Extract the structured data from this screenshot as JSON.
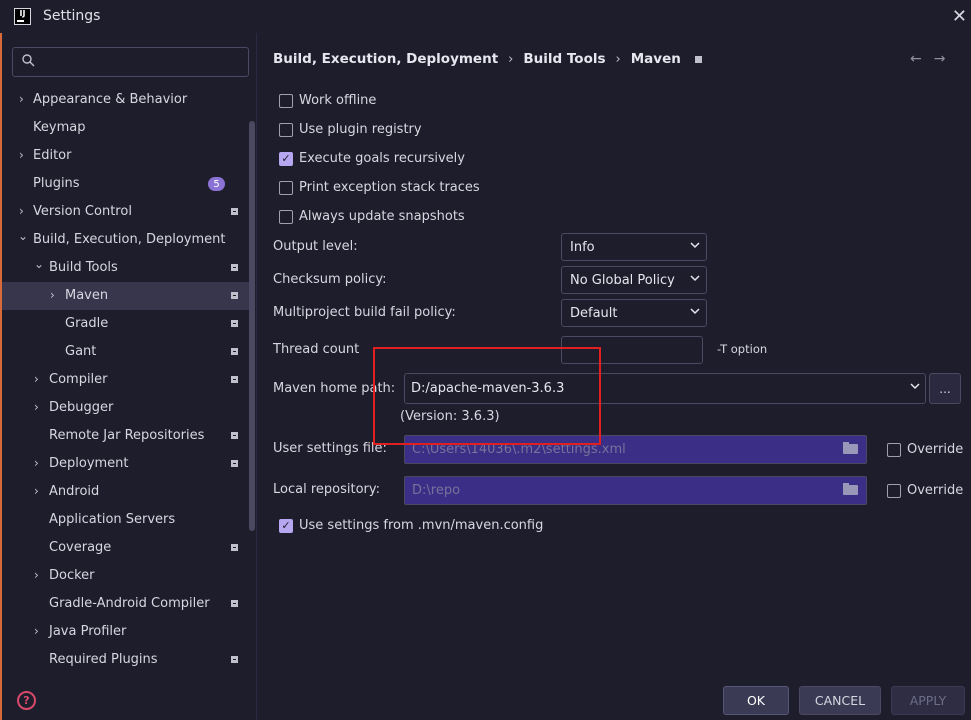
{
  "window": {
    "title": "Settings",
    "logo_text": "IJ",
    "close_glyph": "✕"
  },
  "sidebar": {
    "search": {
      "placeholder": "",
      "value": ""
    },
    "items": [
      {
        "label": "Appearance & Behavior",
        "chevron": "›",
        "expanded": false
      },
      {
        "label": "Keymap"
      },
      {
        "label": "Editor",
        "chevron": "›",
        "expanded": false
      },
      {
        "label": "Plugins",
        "badge": "5"
      },
      {
        "label": "Version Control",
        "chevron": "›",
        "expanded": false
      },
      {
        "label": "Build, Execution, Deployment",
        "chevron": "⌄",
        "expanded": true
      },
      {
        "label": "Build Tools",
        "chevron": "⌄",
        "expanded": true
      },
      {
        "label": "Maven",
        "chevron": "›",
        "selected": true
      },
      {
        "label": "Gradle"
      },
      {
        "label": "Gant"
      },
      {
        "label": "Compiler",
        "chevron": "›"
      },
      {
        "label": "Debugger",
        "chevron": "›"
      },
      {
        "label": "Remote Jar Repositories"
      },
      {
        "label": "Deployment",
        "chevron": "›"
      },
      {
        "label": "Android",
        "chevron": "›"
      },
      {
        "label": "Application Servers"
      },
      {
        "label": "Coverage"
      },
      {
        "label": "Docker",
        "chevron": "›"
      },
      {
        "label": "Gradle-Android Compiler"
      },
      {
        "label": "Java Profiler",
        "chevron": "›"
      },
      {
        "label": "Required Plugins"
      }
    ],
    "help_glyph": "?"
  },
  "breadcrumb": {
    "items": [
      "Build, Execution, Deployment",
      "Build Tools",
      "Maven"
    ],
    "separator": "›",
    "back_glyph": "←",
    "forward_glyph": "→"
  },
  "options": {
    "work_offline": {
      "label": "Work offline",
      "checked": false
    },
    "use_plugin_registry": {
      "label": "Use plugin registry",
      "checked": false
    },
    "execute_goals_recursively": {
      "label": "Execute goals recursively",
      "checked": true
    },
    "print_exception_stack_traces": {
      "label": "Print exception stack traces",
      "checked": false
    },
    "always_update_snapshots": {
      "label": "Always update snapshots",
      "checked": false
    }
  },
  "fields": {
    "output_level": {
      "label": "Output level:",
      "value": "Info"
    },
    "checksum_policy": {
      "label": "Checksum policy:",
      "value": "No Global Policy"
    },
    "multiproject_fail_policy": {
      "label": "Multiproject build fail policy:",
      "value": "Default"
    },
    "thread_count": {
      "label": "Thread count",
      "value": "",
      "suffix": "-T option"
    },
    "maven_home": {
      "label": "Maven home path:",
      "value": "D:/apache-maven-3.6.3",
      "version": "(Version: 3.6.3)",
      "browse_label": "..."
    },
    "user_settings": {
      "label": "User settings file:",
      "value": "C:\\Users\\14036\\.m2\\settings.xml",
      "override_label": "Override",
      "override_checked": false
    },
    "local_repository": {
      "label": "Local repository:",
      "value": "D:\\repo",
      "override_label": "Override",
      "override_checked": false
    },
    "use_mvn_config": {
      "label": "Use settings from .mvn/maven.config",
      "checked": true
    }
  },
  "buttons": {
    "ok": "OK",
    "cancel": "CANCEL",
    "apply": "APPLY"
  },
  "colors": {
    "background": "#1e1d2c",
    "accent": "#b7a6f0",
    "badge": "#8b73d6",
    "disabled_field": "#3a2e86",
    "annotation_box": "#e02020"
  }
}
